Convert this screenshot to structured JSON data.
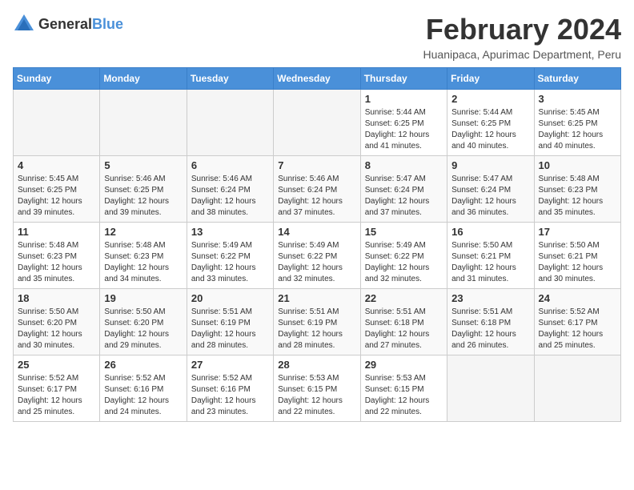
{
  "logo": {
    "general": "General",
    "blue": "Blue"
  },
  "header": {
    "month": "February 2024",
    "location": "Huanipaca, Apurimac Department, Peru"
  },
  "weekdays": [
    "Sunday",
    "Monday",
    "Tuesday",
    "Wednesday",
    "Thursday",
    "Friday",
    "Saturday"
  ],
  "weeks": [
    [
      {
        "day": "",
        "info": ""
      },
      {
        "day": "",
        "info": ""
      },
      {
        "day": "",
        "info": ""
      },
      {
        "day": "",
        "info": ""
      },
      {
        "day": "1",
        "info": "Sunrise: 5:44 AM\nSunset: 6:25 PM\nDaylight: 12 hours\nand 41 minutes."
      },
      {
        "day": "2",
        "info": "Sunrise: 5:44 AM\nSunset: 6:25 PM\nDaylight: 12 hours\nand 40 minutes."
      },
      {
        "day": "3",
        "info": "Sunrise: 5:45 AM\nSunset: 6:25 PM\nDaylight: 12 hours\nand 40 minutes."
      }
    ],
    [
      {
        "day": "4",
        "info": "Sunrise: 5:45 AM\nSunset: 6:25 PM\nDaylight: 12 hours\nand 39 minutes."
      },
      {
        "day": "5",
        "info": "Sunrise: 5:46 AM\nSunset: 6:25 PM\nDaylight: 12 hours\nand 39 minutes."
      },
      {
        "day": "6",
        "info": "Sunrise: 5:46 AM\nSunset: 6:24 PM\nDaylight: 12 hours\nand 38 minutes."
      },
      {
        "day": "7",
        "info": "Sunrise: 5:46 AM\nSunset: 6:24 PM\nDaylight: 12 hours\nand 37 minutes."
      },
      {
        "day": "8",
        "info": "Sunrise: 5:47 AM\nSunset: 6:24 PM\nDaylight: 12 hours\nand 37 minutes."
      },
      {
        "day": "9",
        "info": "Sunrise: 5:47 AM\nSunset: 6:24 PM\nDaylight: 12 hours\nand 36 minutes."
      },
      {
        "day": "10",
        "info": "Sunrise: 5:48 AM\nSunset: 6:23 PM\nDaylight: 12 hours\nand 35 minutes."
      }
    ],
    [
      {
        "day": "11",
        "info": "Sunrise: 5:48 AM\nSunset: 6:23 PM\nDaylight: 12 hours\nand 35 minutes."
      },
      {
        "day": "12",
        "info": "Sunrise: 5:48 AM\nSunset: 6:23 PM\nDaylight: 12 hours\nand 34 minutes."
      },
      {
        "day": "13",
        "info": "Sunrise: 5:49 AM\nSunset: 6:22 PM\nDaylight: 12 hours\nand 33 minutes."
      },
      {
        "day": "14",
        "info": "Sunrise: 5:49 AM\nSunset: 6:22 PM\nDaylight: 12 hours\nand 32 minutes."
      },
      {
        "day": "15",
        "info": "Sunrise: 5:49 AM\nSunset: 6:22 PM\nDaylight: 12 hours\nand 32 minutes."
      },
      {
        "day": "16",
        "info": "Sunrise: 5:50 AM\nSunset: 6:21 PM\nDaylight: 12 hours\nand 31 minutes."
      },
      {
        "day": "17",
        "info": "Sunrise: 5:50 AM\nSunset: 6:21 PM\nDaylight: 12 hours\nand 30 minutes."
      }
    ],
    [
      {
        "day": "18",
        "info": "Sunrise: 5:50 AM\nSunset: 6:20 PM\nDaylight: 12 hours\nand 30 minutes."
      },
      {
        "day": "19",
        "info": "Sunrise: 5:50 AM\nSunset: 6:20 PM\nDaylight: 12 hours\nand 29 minutes."
      },
      {
        "day": "20",
        "info": "Sunrise: 5:51 AM\nSunset: 6:19 PM\nDaylight: 12 hours\nand 28 minutes."
      },
      {
        "day": "21",
        "info": "Sunrise: 5:51 AM\nSunset: 6:19 PM\nDaylight: 12 hours\nand 28 minutes."
      },
      {
        "day": "22",
        "info": "Sunrise: 5:51 AM\nSunset: 6:18 PM\nDaylight: 12 hours\nand 27 minutes."
      },
      {
        "day": "23",
        "info": "Sunrise: 5:51 AM\nSunset: 6:18 PM\nDaylight: 12 hours\nand 26 minutes."
      },
      {
        "day": "24",
        "info": "Sunrise: 5:52 AM\nSunset: 6:17 PM\nDaylight: 12 hours\nand 25 minutes."
      }
    ],
    [
      {
        "day": "25",
        "info": "Sunrise: 5:52 AM\nSunset: 6:17 PM\nDaylight: 12 hours\nand 25 minutes."
      },
      {
        "day": "26",
        "info": "Sunrise: 5:52 AM\nSunset: 6:16 PM\nDaylight: 12 hours\nand 24 minutes."
      },
      {
        "day": "27",
        "info": "Sunrise: 5:52 AM\nSunset: 6:16 PM\nDaylight: 12 hours\nand 23 minutes."
      },
      {
        "day": "28",
        "info": "Sunrise: 5:53 AM\nSunset: 6:15 PM\nDaylight: 12 hours\nand 22 minutes."
      },
      {
        "day": "29",
        "info": "Sunrise: 5:53 AM\nSunset: 6:15 PM\nDaylight: 12 hours\nand 22 minutes."
      },
      {
        "day": "",
        "info": ""
      },
      {
        "day": "",
        "info": ""
      }
    ]
  ]
}
